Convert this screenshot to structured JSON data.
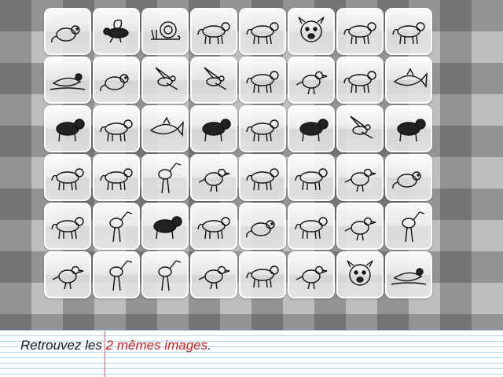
{
  "game": {
    "instruction_prefix": "Retrouvez les ",
    "instruction_highlight": "2 mêmes images",
    "instruction_suffix": ".",
    "highlight_color": "#d42020"
  },
  "cards": [
    {
      "animal": "mouse"
    },
    {
      "animal": "bee"
    },
    {
      "animal": "snail"
    },
    {
      "animal": "elephant"
    },
    {
      "animal": "dog-spotted"
    },
    {
      "animal": "dog-head"
    },
    {
      "animal": "donkey"
    },
    {
      "animal": "chihuahua"
    },
    {
      "animal": "loon"
    },
    {
      "animal": "frog"
    },
    {
      "animal": "eagle-swooping"
    },
    {
      "animal": "seagull"
    },
    {
      "animal": "tiger"
    },
    {
      "animal": "dodo"
    },
    {
      "animal": "bear"
    },
    {
      "animal": "shark"
    },
    {
      "animal": "collie"
    },
    {
      "animal": "lion"
    },
    {
      "animal": "whale"
    },
    {
      "animal": "rabbit"
    },
    {
      "animal": "sheep"
    },
    {
      "animal": "kangaroo"
    },
    {
      "animal": "bird-flying"
    },
    {
      "animal": "walrus"
    },
    {
      "animal": "cow"
    },
    {
      "animal": "rhinoceros"
    },
    {
      "animal": "gazelle"
    },
    {
      "animal": "songbird"
    },
    {
      "animal": "goat"
    },
    {
      "animal": "tiger-crouching"
    },
    {
      "animal": "bald-eagle"
    },
    {
      "animal": "rat"
    },
    {
      "animal": "pig"
    },
    {
      "animal": "stork"
    },
    {
      "animal": "panda"
    },
    {
      "animal": "zebra"
    },
    {
      "animal": "mole"
    },
    {
      "animal": "horse"
    },
    {
      "animal": "rooster"
    },
    {
      "animal": "stork"
    },
    {
      "animal": "goose"
    },
    {
      "animal": "giraffe"
    },
    {
      "animal": "deer"
    },
    {
      "animal": "pigeon"
    },
    {
      "animal": "poodle"
    },
    {
      "animal": "duck"
    },
    {
      "animal": "bear-head"
    },
    {
      "animal": "loon-swimming"
    }
  ]
}
